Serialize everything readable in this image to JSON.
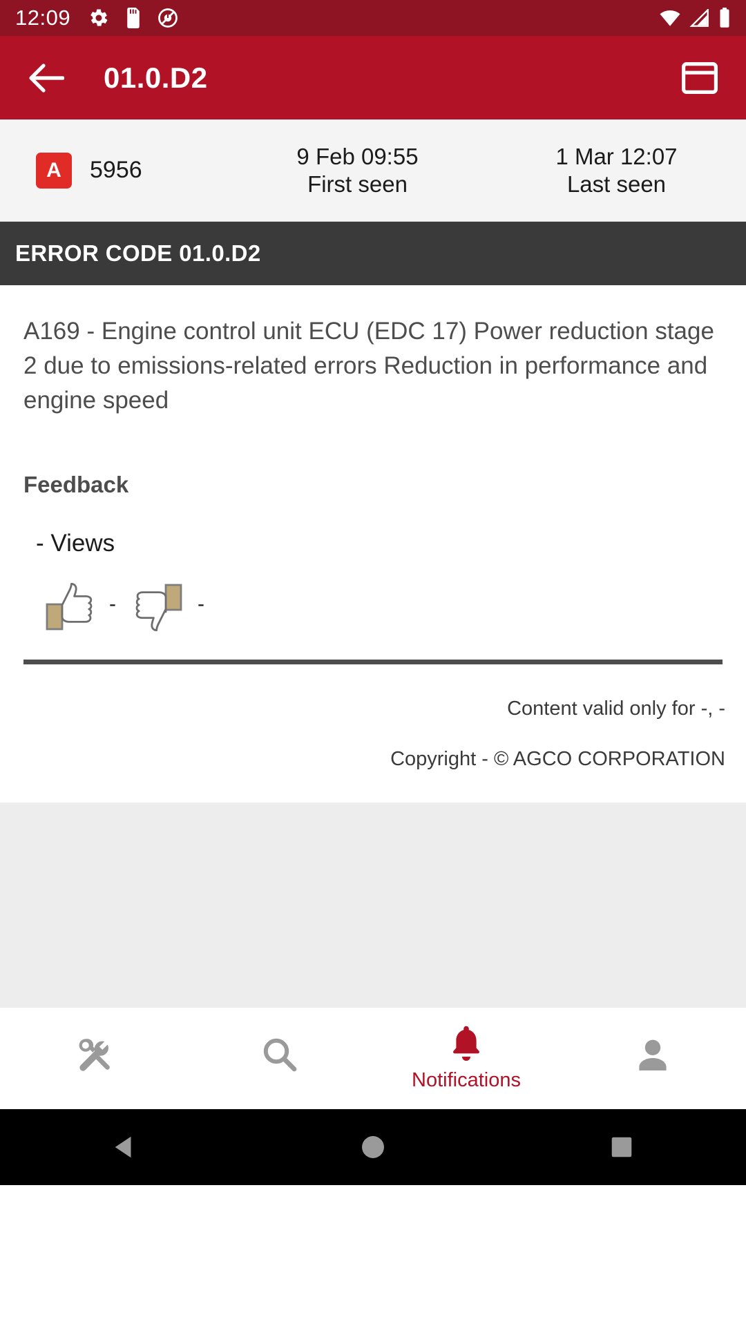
{
  "status_bar": {
    "time": "12:09",
    "left_icons": [
      "gear-icon",
      "sd-card-icon",
      "do-not-disturb-icon"
    ],
    "right_icons": [
      "wifi-icon",
      "cellular-signal-icon",
      "battery-icon"
    ],
    "background_color": "#8E1424"
  },
  "app_bar": {
    "back_label": "Back",
    "title": "01.0.D2",
    "action_icon": "web-asset-icon",
    "background_color": "#B11226"
  },
  "info_row": {
    "severity_badge": "A",
    "severity_badge_color": "#E02B27",
    "occurrence_count": "5956",
    "first_seen": {
      "value": "9 Feb 09:55",
      "label": "First seen"
    },
    "last_seen": {
      "value": "1 Mar 12:07",
      "label": "Last seen"
    }
  },
  "code_band": {
    "title": "ERROR CODE 01.0.D2",
    "background_color": "#3A3A3A"
  },
  "article": {
    "description": "A169 - Engine control unit ECU (EDC 17) Power reduction stage 2 due to emissions-related errors Reduction in performance and engine speed",
    "feedback_heading": "Feedback",
    "views_line": "- Views",
    "thumbs_up_count": "-",
    "thumbs_down_count": "-"
  },
  "legal": {
    "validity": "Content valid only for -, -",
    "copyright": "Copyright - © AGCO CORPORATION"
  },
  "bottom_nav": {
    "active_color": "#B11226",
    "items": [
      {
        "icon": "service-tools-icon",
        "label": "",
        "active": false
      },
      {
        "icon": "search-icon",
        "label": "",
        "active": false
      },
      {
        "icon": "bell-icon",
        "label": "Notifications",
        "active": true
      },
      {
        "icon": "person-icon",
        "label": "",
        "active": false
      }
    ]
  },
  "android_nav": {
    "back": "back-triangle-icon",
    "home": "home-circle-icon",
    "recents": "recents-square-icon"
  }
}
